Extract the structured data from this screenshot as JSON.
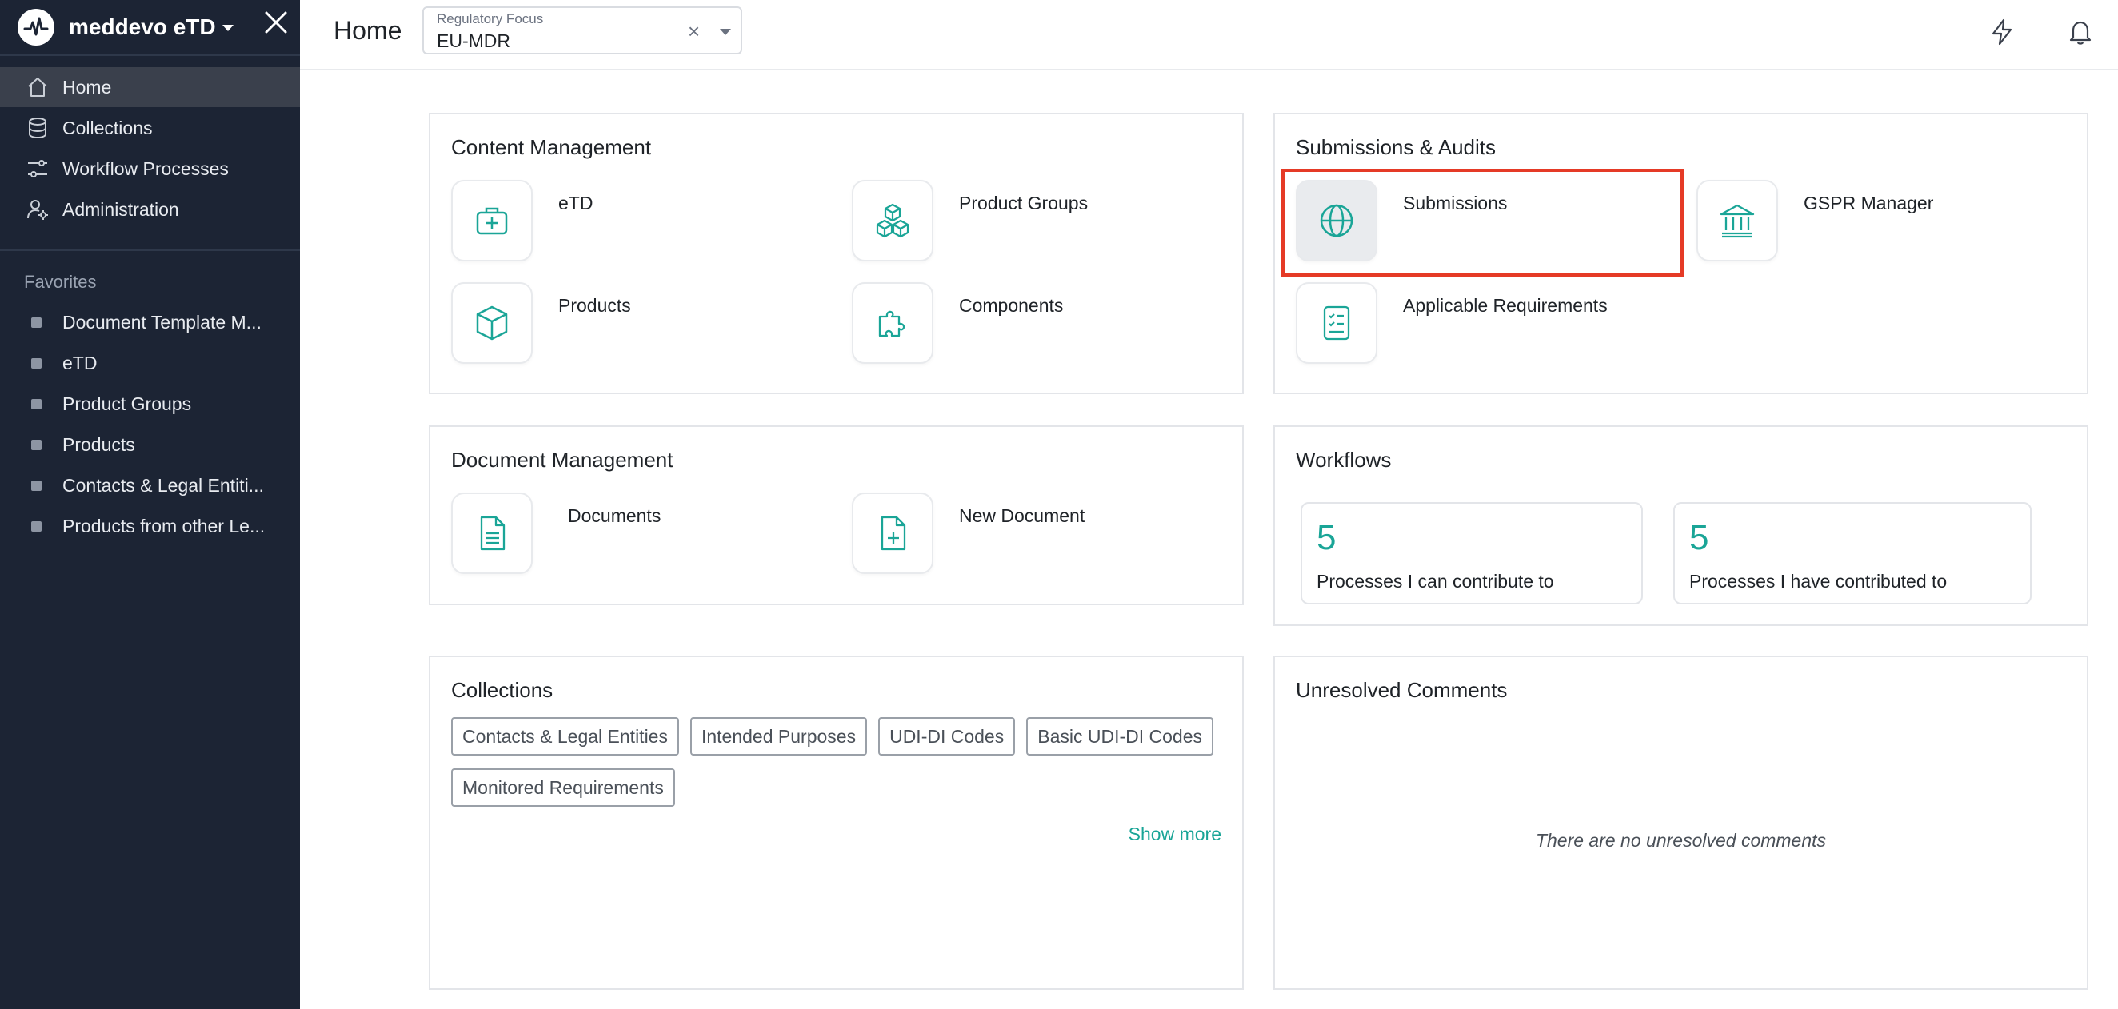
{
  "colors": {
    "sidebar_bg": "#1c2434",
    "accent": "#1aa597",
    "highlight": "#e53a26"
  },
  "sidebar": {
    "brand": "meddevo eTD",
    "nav": [
      {
        "label": "Home",
        "icon": "home-icon",
        "active": true
      },
      {
        "label": "Collections",
        "icon": "database-icon"
      },
      {
        "label": "Workflow Processes",
        "icon": "workflow-icon"
      },
      {
        "label": "Administration",
        "icon": "admin-user-icon"
      }
    ],
    "favorites_title": "Favorites",
    "favorites": [
      "Document Template M...",
      "eTD",
      "Product Groups",
      "Products",
      "Contacts & Legal Entiti...",
      "Products from other Le..."
    ]
  },
  "header": {
    "title": "Home",
    "regulatory_focus": {
      "label": "Regulatory Focus",
      "value": "EU-MDR",
      "clear": "×"
    }
  },
  "content_management": {
    "title": "Content Management",
    "tiles": [
      {
        "label": "eTD",
        "icon": "medical-kit-icon"
      },
      {
        "label": "Product Groups",
        "icon": "cubes-icon"
      },
      {
        "label": "Products",
        "icon": "box-icon"
      },
      {
        "label": "Components",
        "icon": "puzzle-icon"
      }
    ]
  },
  "submissions_audits": {
    "title": "Submissions & Audits",
    "tiles": [
      {
        "label": "Submissions",
        "icon": "globe-icon"
      },
      {
        "label": "GSPR Manager",
        "icon": "bank-icon"
      },
      {
        "label": "Applicable Requirements",
        "icon": "checklist-icon"
      }
    ]
  },
  "document_management": {
    "title": "Document Management",
    "tiles": [
      {
        "label": "Documents",
        "icon": "document-icon"
      },
      {
        "label": "New Document",
        "icon": "new-document-icon"
      }
    ]
  },
  "workflows": {
    "title": "Workflows",
    "stats": [
      {
        "value": "5",
        "label": "Processes I can contribute to"
      },
      {
        "value": "5",
        "label": "Processes I have contributed to"
      }
    ]
  },
  "collections": {
    "title": "Collections",
    "chips": [
      "Contacts & Legal Entities",
      "Intended Purposes",
      "UDI-DI Codes",
      "Basic UDI-DI Codes",
      "Monitored Requirements"
    ],
    "show_more": "Show more"
  },
  "unresolved_comments": {
    "title": "Unresolved Comments",
    "empty": "There are no unresolved comments"
  }
}
